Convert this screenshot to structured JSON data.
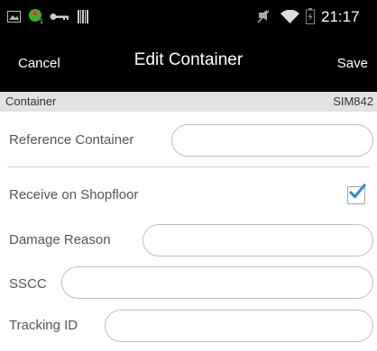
{
  "status_bar": {
    "time": "21:17",
    "icons": [
      "image-icon",
      "android-notification-icon",
      "key-icon",
      "barcode-icon",
      "mute-icon",
      "wifi-icon",
      "battery-icon"
    ]
  },
  "nav": {
    "cancel_label": "Cancel",
    "title": "Edit Container",
    "save_label": "Save"
  },
  "container_header": {
    "label": "Container",
    "value": "SIM842"
  },
  "form": {
    "reference_container": {
      "label": "Reference Container",
      "value": ""
    },
    "receive_on_shopfloor": {
      "label": "Receive on Shopfloor",
      "checked": true
    },
    "damage_reason": {
      "label": "Damage Reason",
      "value": ""
    },
    "sscc": {
      "label": "SSCC",
      "value": ""
    },
    "tracking_id": {
      "label": "Tracking ID",
      "value": ""
    }
  },
  "colors": {
    "bar_background": "#000000",
    "header_background": "#e2e2e2",
    "checkmark": "#3a86c4"
  }
}
